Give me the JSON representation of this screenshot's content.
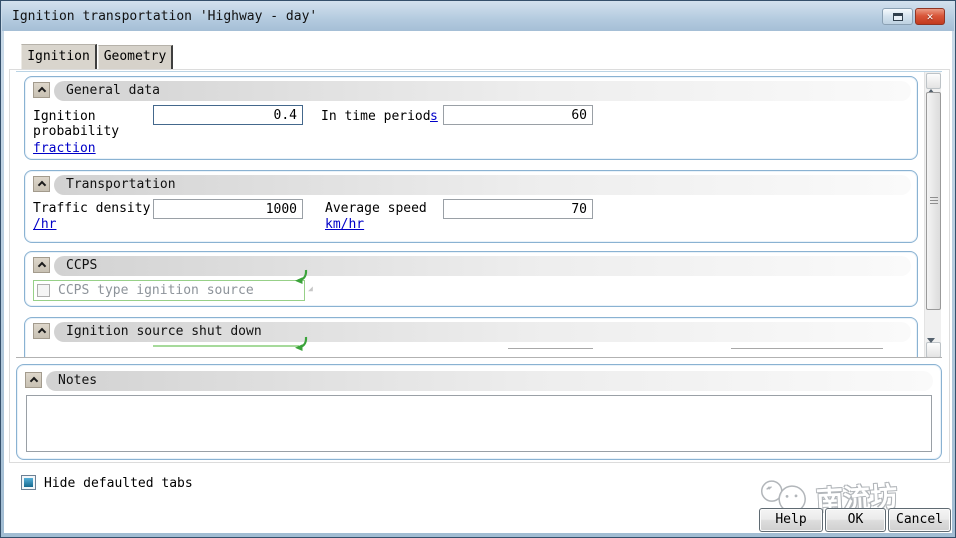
{
  "window": {
    "title": "Ignition transportation 'Highway - day'"
  },
  "tabs": {
    "ignition": "Ignition",
    "geometry": "Geometry"
  },
  "sections": {
    "general": {
      "title": "General data",
      "probability": {
        "label": "Ignition probability",
        "unit_link": "fraction",
        "value": "0.4"
      },
      "time_period": {
        "label": "In time period",
        "unit_link": "s",
        "value": "60"
      }
    },
    "transportation": {
      "title": "Transportation",
      "traffic_density": {
        "label": "Traffic density",
        "unit_link": "/hr",
        "value": "1000"
      },
      "average_speed": {
        "label": "Average speed",
        "unit_link": "km/hr",
        "value": "70"
      }
    },
    "ccps": {
      "title": "CCPS",
      "checkbox_label": "CCPS type ignition source",
      "checked": false
    },
    "shutdown": {
      "title": "Ignition source shut down"
    },
    "notes": {
      "title": "Notes",
      "text": ""
    }
  },
  "footer": {
    "hide_tabs_label": "Hide defaulted tabs",
    "hide_tabs_checked": true,
    "help": "Help",
    "ok": "OK",
    "cancel": "Cancel"
  },
  "watermark": {
    "text": "南流坊"
  },
  "colors": {
    "panel_border": "#8ab2d2",
    "link": "#0000c8",
    "ccps_green_border": "#97d088",
    "close_button_red": "#c23a1e",
    "titlebar_blue": "#b4cbdf",
    "checkbox_fill_blue": "#16698f"
  }
}
